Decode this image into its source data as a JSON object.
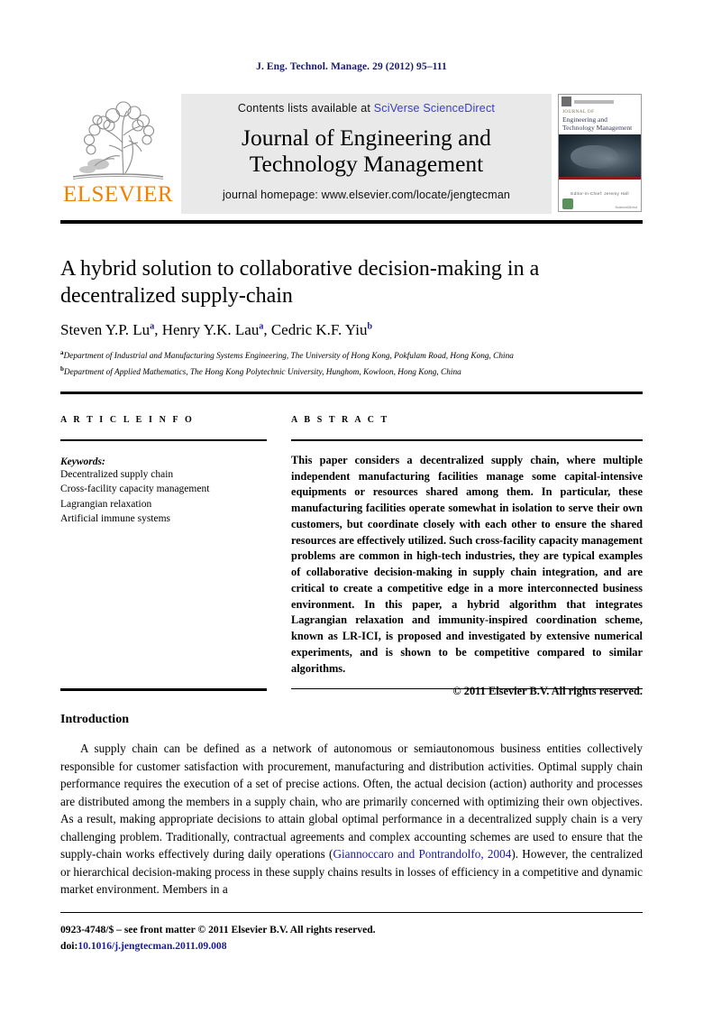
{
  "running_head": "J. Eng. Technol. Manage. 29 (2012) 95–111",
  "masthead": {
    "publisher_wordmark": "ELSEVIER",
    "contents_prefix": "Contents lists available at ",
    "contents_link": "SciVerse ScienceDirect",
    "journal_title_line1": "Journal of Engineering and",
    "journal_title_line2": "Technology Management",
    "homepage": "journal homepage: www.elsevier.com/locate/jengtecman",
    "cover": {
      "title_small": "JOURNAL OF",
      "title_line1": "Engineering and",
      "title_line2": "Technology Management",
      "editor": "Editor-in-Chief: Jeremy Hall"
    }
  },
  "article": {
    "title": "A hybrid solution to collaborative decision-making in a decentralized supply-chain",
    "authors": [
      {
        "name": "Steven Y.P. Lu",
        "marker": "a"
      },
      {
        "name": "Henry Y.K. Lau",
        "marker": "a"
      },
      {
        "name": "Cedric K.F. Yiu",
        "marker": "b"
      }
    ],
    "affiliations": [
      {
        "marker": "a",
        "text": "Department of Industrial and Manufacturing Systems Engineering, The University of Hong Kong, Pokfulam Road, Hong Kong, China"
      },
      {
        "marker": "b",
        "text": "Department of Applied Mathematics, The Hong Kong Polytechnic University, Hunghom, Kowloon, Hong Kong, China"
      }
    ]
  },
  "article_info": {
    "heading": "A R T I C L E   I N F O",
    "keywords_label": "Keywords:",
    "keywords": [
      "Decentralized supply chain",
      "Cross-facility capacity management",
      "Lagrangian relaxation",
      "Artificial immune systems"
    ]
  },
  "abstract": {
    "heading": "A B S T R A C T",
    "text": "This paper considers a decentralized supply chain, where multiple independent manufacturing facilities manage some capital-intensive equipments or resources shared among them. In particular, these manufacturing facilities operate somewhat in isolation to serve their own customers, but coordinate closely with each other to ensure the shared resources are effectively utilized. Such cross-facility capacity management problems are common in high-tech industries, they are typical examples of collaborative decision-making in supply chain integration, and are critical to create a competitive edge in a more interconnected business environment. In this paper, a hybrid algorithm that integrates Lagrangian relaxation and immunity-inspired coordination scheme, known as LR-ICI, is proposed and investigated by extensive numerical experiments, and is shown to be competitive compared to similar algorithms.",
    "copyright": "© 2011 Elsevier B.V. All rights reserved."
  },
  "introduction": {
    "heading": "Introduction",
    "paragraph_part1": "A supply chain can be defined as a network of autonomous or semiautonomous business entities collectively responsible for customer satisfaction with procurement, manufacturing and distribution activities. Optimal supply chain performance requires the execution of a set of precise actions. Often, the actual decision (action) authority and processes are distributed among the members in a supply chain, who are primarily concerned with optimizing their own objectives. As a result, making appropriate decisions to attain global optimal performance in a decentralized supply chain is a very challenging problem. Traditionally, contractual agreements and complex accounting schemes are used to ensure that the supply-chain works effectively during daily operations (",
    "citation": "Giannoccaro and Pontrandolfo, 2004",
    "paragraph_part2": "). However, the centralized or hierarchical decision-making process in these supply chains results in losses of efficiency in a competitive and dynamic market environment. Members in a"
  },
  "footer": {
    "front_matter": "0923-4748/$ – see front matter © 2011 Elsevier B.V. All rights reserved.",
    "doi_label": "doi:",
    "doi_value": "10.1016/j.jengtecman.2011.09.008"
  },
  "colors": {
    "running_head": "#1a1a66",
    "link_blue": "#3a3ad0",
    "citation_blue": "#1a1a99",
    "elsevier_orange": "#f08000",
    "band_grey": "#e9e9e9"
  }
}
